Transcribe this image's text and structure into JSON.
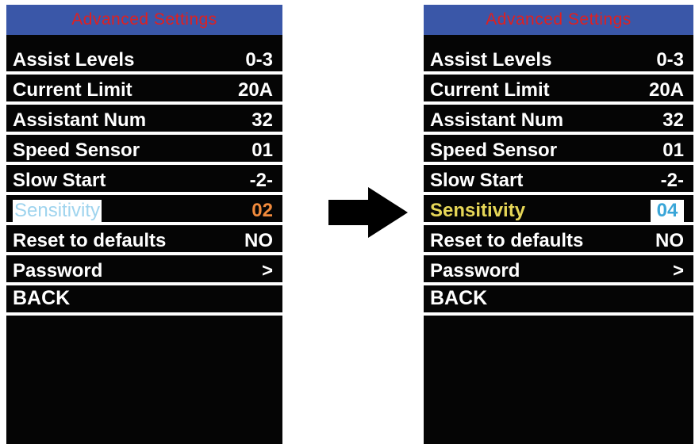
{
  "title": "Advanced Settings",
  "left": {
    "rows": [
      {
        "label": "Assist Levels",
        "value": "0-3"
      },
      {
        "label": "Current Limit",
        "value": "20A"
      },
      {
        "label": "Assistant Num",
        "value": "32"
      },
      {
        "label": "Speed Sensor",
        "value": "01"
      },
      {
        "label": "Slow Start",
        "value": "-2-"
      },
      {
        "label": "Sensitivity",
        "value": "02"
      },
      {
        "label": "Reset to defaults",
        "value": "NO"
      },
      {
        "label": "Password",
        "value": ">"
      },
      {
        "label": "BACK",
        "value": ""
      }
    ]
  },
  "right": {
    "rows": [
      {
        "label": "Assist Levels",
        "value": "0-3"
      },
      {
        "label": "Current Limit",
        "value": "20A"
      },
      {
        "label": "Assistant Num",
        "value": "32"
      },
      {
        "label": "Speed Sensor",
        "value": "01"
      },
      {
        "label": "Slow Start",
        "value": "-2-"
      },
      {
        "label": "Sensitivity",
        "value": "04"
      },
      {
        "label": "Reset to defaults",
        "value": "NO"
      },
      {
        "label": "Password",
        "value": ">"
      },
      {
        "label": "BACK",
        "value": ""
      }
    ]
  },
  "colors": {
    "title_bg": "#3a57a8",
    "title_text": "#e02020",
    "screen_bg": "#050505",
    "sensitivity_left_label": "#9fd4ee",
    "sensitivity_left_value": "#f08a3c",
    "sensitivity_right_label": "#e6d657",
    "sensitivity_right_value": "#3aa6d8"
  },
  "icons": {
    "transition": "right-arrow-icon"
  }
}
